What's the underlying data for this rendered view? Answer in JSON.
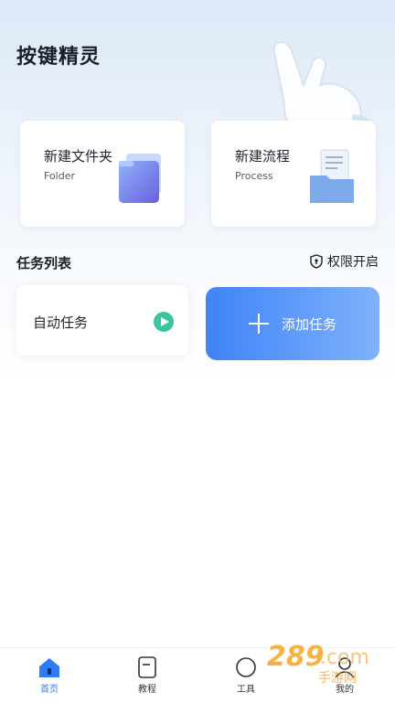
{
  "header": {
    "title": "按键精灵"
  },
  "cards": [
    {
      "title": "新建文件夹",
      "subtitle": "Folder"
    },
    {
      "title": "新建流程",
      "subtitle": "Process"
    }
  ],
  "tasks": {
    "section_title": "任务列表",
    "permission_label": "权限开启",
    "items": [
      {
        "label": "自动任务"
      }
    ],
    "add_label": "添加任务"
  },
  "tabbar": {
    "items": [
      {
        "label": "首页",
        "icon": "home-icon",
        "active": true
      },
      {
        "label": "教程",
        "icon": "tutorial-icon",
        "active": false
      },
      {
        "label": "工具",
        "icon": "tool-icon",
        "active": false
      },
      {
        "label": "我的",
        "icon": "profile-icon",
        "active": false
      }
    ]
  },
  "watermark": {
    "text": "289.com",
    "sub": "手游网"
  },
  "colors": {
    "accent": "#2f7cf6",
    "play": "#3bc4a0"
  }
}
